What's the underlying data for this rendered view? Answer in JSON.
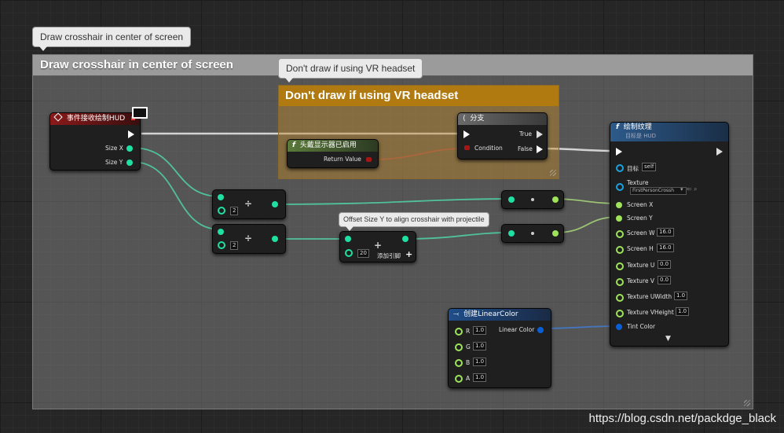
{
  "outer_comment": {
    "bubble": "Draw crosshair in center of screen",
    "title": "Draw crosshair in center of screen"
  },
  "vr_comment": {
    "bubble": "Don't draw if using VR headset",
    "title": "Don't draw if using VR headset"
  },
  "event_node": {
    "title": "事件接收绘制HUD",
    "size_x": "Size X",
    "size_y": "Size Y"
  },
  "hmd_node": {
    "title": "头戴显示器已启用",
    "return_value": "Return Value"
  },
  "branch_node": {
    "title": "分支",
    "condition": "Condition",
    "true_label": "True",
    "false_label": "False"
  },
  "divide_nodes": [
    {
      "operator": "÷",
      "value": "2"
    },
    {
      "operator": "÷",
      "value": "2"
    }
  ],
  "add_node": {
    "bubble": "Offset Size Y to align crosshair with projectile",
    "operator": "+",
    "value": "20",
    "add_pin": "添加引脚"
  },
  "reroute_nodes": [
    {
      "symbol": "•"
    },
    {
      "symbol": "•"
    }
  ],
  "linear_color_node": {
    "title": "创建LinearColor",
    "output": "Linear Color",
    "inputs": [
      {
        "label": "R",
        "value": "1.0"
      },
      {
        "label": "G",
        "value": "1.0"
      },
      {
        "label": "B",
        "value": "1.0"
      },
      {
        "label": "A",
        "value": "1.0"
      }
    ]
  },
  "draw_texture_node": {
    "title": "绘制纹理",
    "subtitle": "目标是 HUD",
    "target_label": "目标",
    "target_value": "self",
    "texture_label": "Texture",
    "texture_value": "FirstPersonCrossh",
    "params": [
      {
        "label": "Screen X",
        "value": ""
      },
      {
        "label": "Screen Y",
        "value": ""
      },
      {
        "label": "Screen W",
        "value": "16.0"
      },
      {
        "label": "Screen H",
        "value": "16.0"
      },
      {
        "label": "Texture U",
        "value": "0.0"
      },
      {
        "label": "Texture V",
        "value": "0.0"
      },
      {
        "label": "Texture UWidth",
        "value": "1.0"
      },
      {
        "label": "Texture VHeight",
        "value": "1.0"
      },
      {
        "label": "Tint Color",
        "value": ""
      }
    ]
  },
  "watermark": "https://blog.csdn.net/packdge_black",
  "colors": {
    "exec": "#ffffff",
    "float": "#9ee35a",
    "bool": "#a31717",
    "int": "#1fe0a2",
    "struct": "#0a5fd6",
    "object": "#1aa2e0"
  }
}
